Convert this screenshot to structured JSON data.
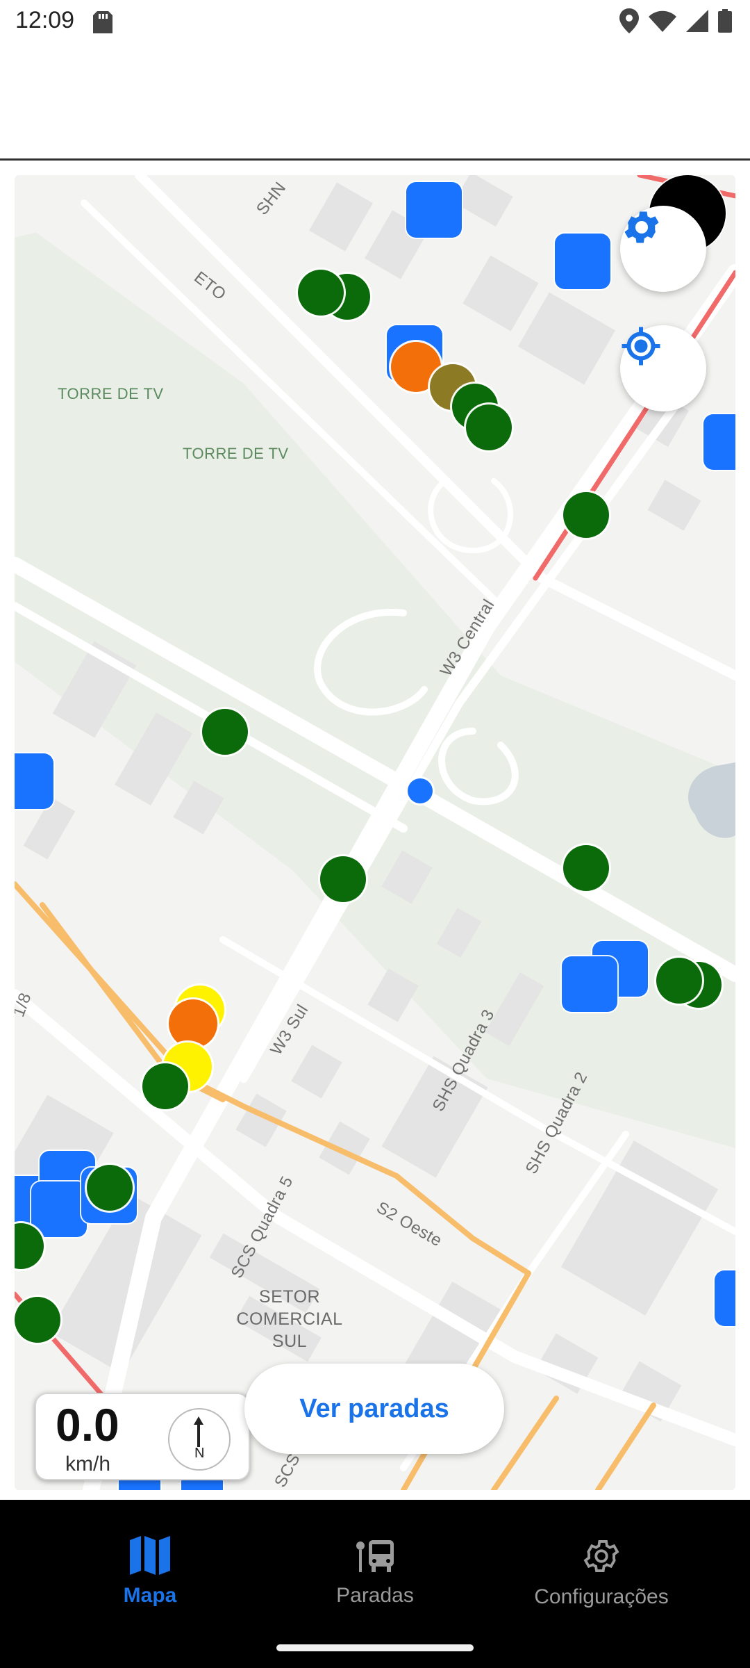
{
  "status_bar": {
    "time": "12:09",
    "icons": [
      "sd-card-icon",
      "location-icon",
      "wifi-icon",
      "signal-icon",
      "battery-icon"
    ]
  },
  "map": {
    "labels": {
      "torre1": "TORRE DE TV",
      "torre2": "TORRE DE TV",
      "eto": "ETO",
      "shn": "SHN",
      "w3_central": "W3 Central",
      "w3_sul": "W3 Sul",
      "shs_q3": "SHS Quadra 3",
      "shs_q2": "SHS Quadra 2",
      "scs_q5": "SCS Quadra 5",
      "s2_oeste": "S2 Oeste",
      "setor_line1": "SETOR",
      "setor_line2": "COMERCIAL",
      "setor_line3": "SUL",
      "edge_78": "1/8",
      "scs_bottom": "SCS"
    },
    "colors": {
      "bus": "#1a73fe",
      "stop_green": "#0b6b0b",
      "stop_orange": "#f36f0a",
      "stop_yellow": "#fff200",
      "stop_olive": "#8c7a25",
      "route_red": "#f06a6a",
      "route_orange": "#f7bd6b"
    }
  },
  "speed": {
    "value": "0.0",
    "unit": "km/h",
    "compass_label": "N"
  },
  "buttons": {
    "ver_paradas": "Ver paradas",
    "settings_icon": "gear-icon",
    "locate_icon": "crosshair-icon"
  },
  "nav": {
    "items": [
      {
        "label": "Mapa",
        "icon": "map-icon",
        "active": true
      },
      {
        "label": "Paradas",
        "icon": "bus-stop-icon",
        "active": false
      },
      {
        "label": "Configurações",
        "icon": "gear-icon",
        "active": false
      }
    ]
  }
}
